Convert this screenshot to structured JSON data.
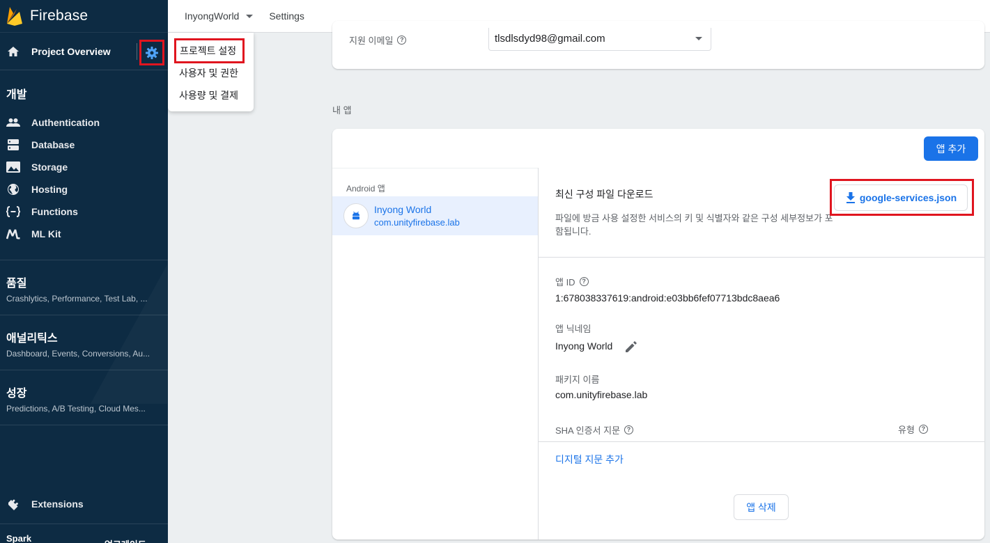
{
  "sidebar": {
    "brand": "Firebase",
    "project_overview": "Project Overview",
    "develop_heading": "개발",
    "develop_items": [
      {
        "label": "Authentication",
        "icon": "people-icon"
      },
      {
        "label": "Database",
        "icon": "database-icon"
      },
      {
        "label": "Storage",
        "icon": "image-icon"
      },
      {
        "label": "Hosting",
        "icon": "globe-icon"
      },
      {
        "label": "Functions",
        "icon": "functions-icon"
      },
      {
        "label": "ML Kit",
        "icon": "mlkit-icon"
      }
    ],
    "groups": [
      {
        "title": "품질",
        "subtitle": "Crashlytics, Performance, Test Lab, ..."
      },
      {
        "title": "애널리틱스",
        "subtitle": "Dashboard, Events, Conversions, Au..."
      },
      {
        "title": "성장",
        "subtitle": "Predictions, A/B Testing, Cloud Mes..."
      }
    ],
    "extensions": "Extensions",
    "plan": "Spark",
    "upgrade": "업그레이드"
  },
  "topbar": {
    "project": "InyongWorld",
    "settings": "Settings"
  },
  "settings_menu": {
    "items": [
      "프로젝트 설정",
      "사용자 및 권한",
      "사용량 및 결제"
    ]
  },
  "support_email": {
    "label": "지원 이메일",
    "value": "tlsdlsdyd98@gmail.com"
  },
  "my_apps": {
    "heading": "내 앱",
    "add_app": "앱 추가",
    "android_heading": "Android 앱",
    "app": {
      "name": "Inyong World",
      "package": "com.unityfirebase.lab"
    },
    "download": {
      "title": "최신 구성 파일 다운로드",
      "description": "파일에 방금 사용 설정한 서비스의 키 및 식별자와 같은 구성 세부정보가 포함됩니다.",
      "button": "google-services.json"
    },
    "fields": {
      "app_id_label": "앱 ID",
      "app_id": "1:678038337619:android:e03bb6fef07713bdc8aea6",
      "nickname_label": "앱 닉네임",
      "nickname": "Inyong World",
      "package_label": "패키지 이름",
      "package": "com.unityfirebase.lab",
      "sha_label": "SHA 인증서 지문",
      "type_label": "유형"
    },
    "add_fingerprint": "디지털 지문 추가",
    "delete_app": "앱 삭제"
  },
  "colors": {
    "sidebar_bg": "#0d2b43",
    "accent": "#1a73e8",
    "highlight": "#e0151f",
    "gear": "#4fa3f7"
  }
}
